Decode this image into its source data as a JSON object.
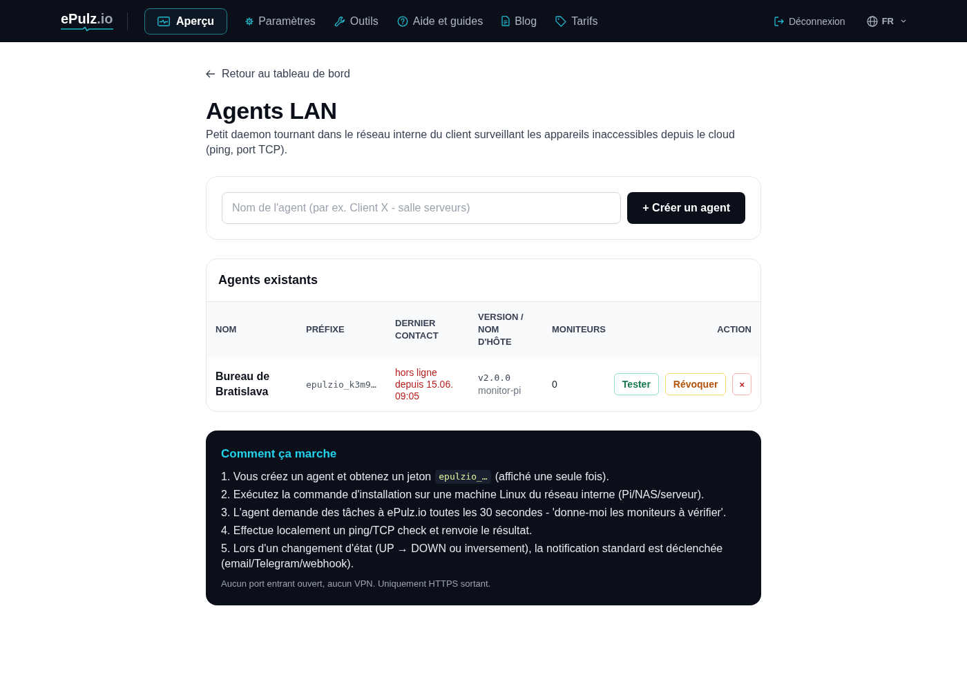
{
  "nav": {
    "logo": {
      "name": "ePulz",
      "suffix": ".io"
    },
    "items": [
      {
        "kind": "overview",
        "label": "Aperçu",
        "selected": true
      },
      {
        "kind": "settings",
        "label": "Paramètres",
        "selected": false
      },
      {
        "kind": "tools",
        "label": "Outils",
        "selected": false
      },
      {
        "kind": "help",
        "label": "Aide et guides",
        "selected": false
      },
      {
        "kind": "blog",
        "label": "Blog",
        "selected": false
      },
      {
        "kind": "pricing",
        "label": "Tarifs",
        "selected": false
      }
    ],
    "logout": {
      "label": "Déconnexion"
    },
    "language": {
      "label": "FR"
    }
  },
  "back_link": {
    "label": "Retour au tableau de bord"
  },
  "title": "Agents LAN",
  "description": "Petit daemon tournant dans le réseau interne du client surveillant les appareils inaccessibles depuis le cloud (ping, port TCP).",
  "create_form": {
    "placeholder": "Nom de l'agent (par ex. Client X - salle serveurs)",
    "button": "+ Créer un agent"
  },
  "agents": {
    "heading": "Agents existants",
    "columns": [
      "NOM",
      "PRÉFIXE",
      "DERNIER CONTACT",
      "VERSION / NOM D'HÔTE",
      "MONITEURS",
      "ACTION"
    ],
    "rows": [
      {
        "name": "Bureau de Bratislava",
        "prefix": "epulzio_k3m9…",
        "last_contact": "hors ligne depuis 15.06. 09:05",
        "online": false,
        "version": "v2.0.0",
        "hostname": "monitor-pi",
        "monitors": "0",
        "actions": [
          {
            "kind": "test",
            "label": "Tester"
          },
          {
            "kind": "revoke",
            "label": "Révoquer"
          },
          {
            "kind": "delete",
            "label": "×"
          }
        ]
      }
    ]
  },
  "how_it_works": {
    "heading": "Comment ça marche",
    "steps": [
      {
        "parts": [
          {
            "kind": "text",
            "text": "1. Vous créez un agent et obtenez un jeton"
          },
          {
            "kind": "code",
            "text": "epulzio_…"
          },
          {
            "kind": "text",
            "text": "(affiché une seule fois)."
          }
        ]
      },
      {
        "parts": [
          {
            "kind": "text",
            "text": "2. Exécutez la commande d'installation sur une machine Linux du réseau interne (Pi/NAS/serveur)."
          }
        ]
      },
      {
        "parts": [
          {
            "kind": "text",
            "text": "3. L'agent demande des tâches à ePulz.io toutes les 30 secondes - 'donne-moi les moniteurs à vérifier'."
          }
        ]
      },
      {
        "parts": [
          {
            "kind": "text",
            "text": "4. Effectue localement un ping/TCP check et renvoie le résultat."
          }
        ]
      },
      {
        "parts": [
          {
            "kind": "text",
            "text": "5. Lors d'un changement d'état (UP → DOWN ou inversement), la notification standard est déclenchée (email/Telegram/webhook)."
          }
        ]
      }
    ],
    "note": "Aucun port entrant ouvert, aucun VPN. Uniquement HTTPS sortant."
  }
}
